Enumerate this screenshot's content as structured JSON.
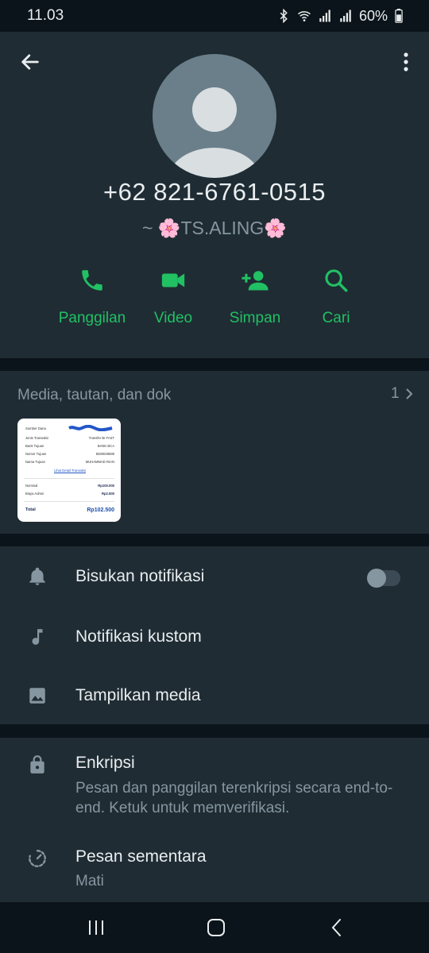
{
  "status_bar": {
    "time": "11.03",
    "battery": "60%",
    "icons": [
      "bluetooth-icon",
      "wifi-icon",
      "signal-icon",
      "signal-icon",
      "battery-icon"
    ]
  },
  "contact": {
    "phone": "+62 821-6761-0515",
    "alias": "~ 🌸TS.ALING🌸"
  },
  "actions": [
    {
      "label": "Panggilan",
      "icon": "phone-icon"
    },
    {
      "label": "Video",
      "icon": "video-icon"
    },
    {
      "label": "Simpan",
      "icon": "add-contact-icon"
    },
    {
      "label": "Cari",
      "icon": "search-icon"
    }
  ],
  "media": {
    "title": "Media, tautan, dan dok",
    "count": "1",
    "thumbnail": {
      "rows": [
        {
          "k": "Sumber Dana",
          "v": ""
        },
        {
          "k": "Jenis Transaksi",
          "v": "Transfer BI FAST"
        },
        {
          "k": "Bank Tujuan",
          "v": "BANK BCA"
        },
        {
          "k": "Nomor Tujuan",
          "v": "8280028589"
        },
        {
          "k": "Nama Tujuan",
          "v": "MUHAMMAD RIAN"
        }
      ],
      "link": "Lihat Detail Transaksi",
      "nominal_label": "Nominal",
      "nominal": "Rp100.000",
      "fee_label": "Biaya Admin",
      "fee": "Rp2.500",
      "total_label": "Total",
      "total": "Rp102.500"
    }
  },
  "settings": [
    {
      "label": "Bisukan notifikasi",
      "icon": "bell-icon",
      "toggle": false
    },
    {
      "label": "Notifikasi kustom",
      "icon": "music-note-icon"
    },
    {
      "label": "Tampilkan media",
      "icon": "image-icon"
    }
  ],
  "encryption": {
    "title": "Enkripsi",
    "subtitle": "Pesan dan panggilan terenkripsi secara end-to-end. Ketuk untuk memverifikasi.",
    "icon": "lock-icon"
  },
  "disappearing": {
    "title": "Pesan sementara",
    "value": "Mati",
    "icon": "timer-icon"
  },
  "colors": {
    "accent": "#21c063",
    "background": "#0b141a",
    "surface": "#1f2c34",
    "secondary_text": "#8696a0"
  }
}
